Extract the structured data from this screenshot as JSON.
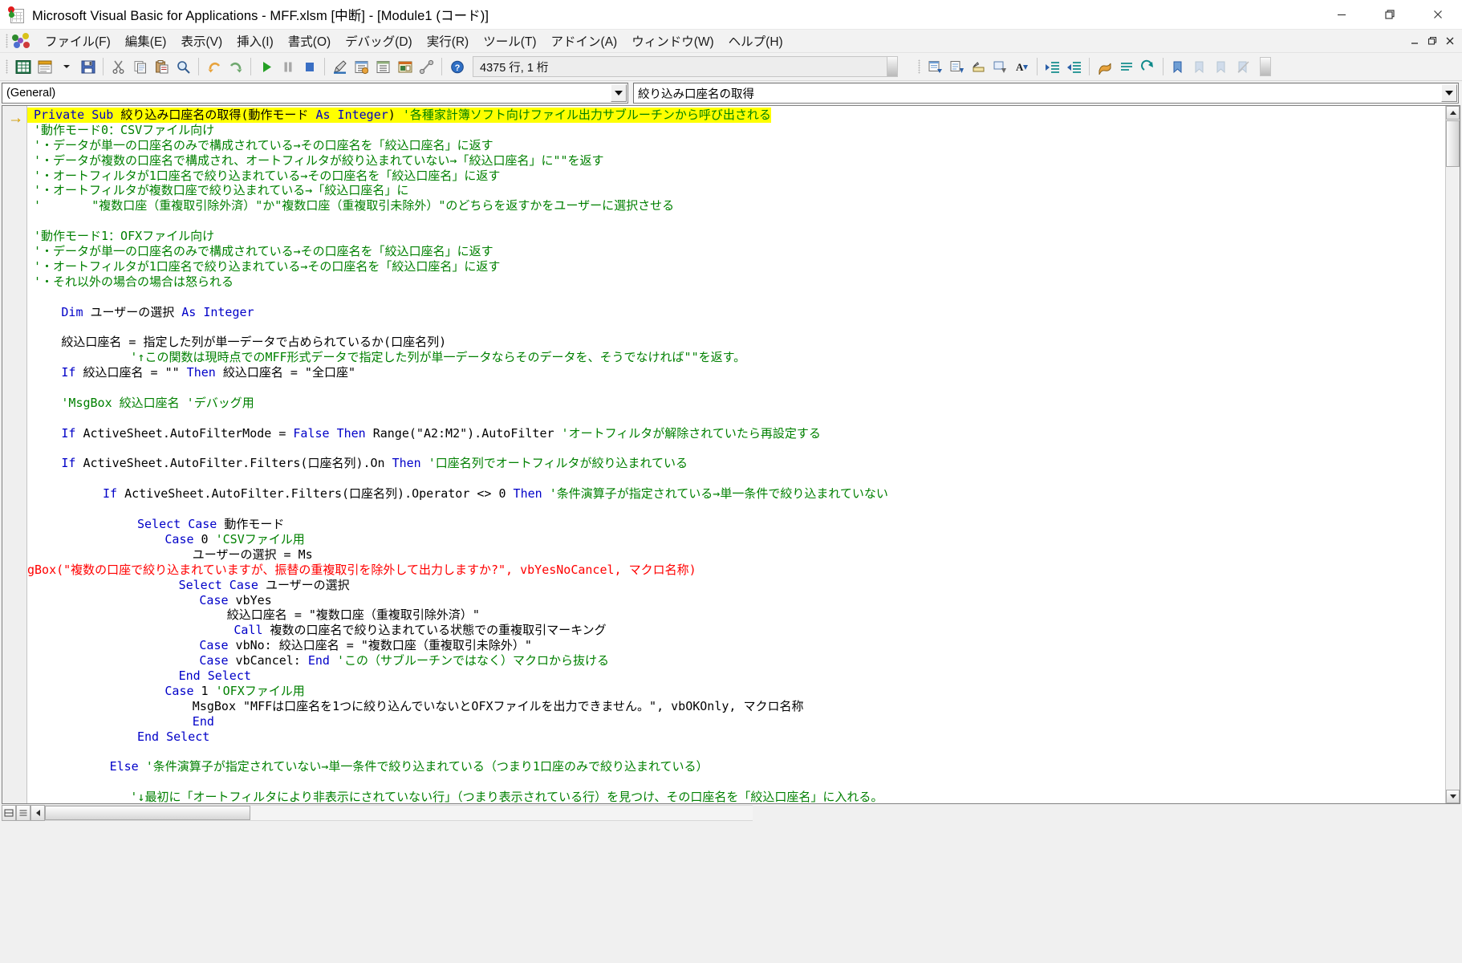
{
  "window": {
    "title": "Microsoft Visual Basic for Applications - MFF.xlsm [中断] - [Module1 (コード)]",
    "icon": "vba-excel-icon",
    "minimize_label": "最小化",
    "restore_label": "元のサイズに戻す",
    "close_label": "閉じる"
  },
  "menubar": {
    "items": [
      {
        "label": "ファイル(F)",
        "name": "menu-file"
      },
      {
        "label": "編集(E)",
        "name": "menu-edit"
      },
      {
        "label": "表示(V)",
        "name": "menu-view"
      },
      {
        "label": "挿入(I)",
        "name": "menu-insert"
      },
      {
        "label": "書式(O)",
        "name": "menu-format"
      },
      {
        "label": "デバッグ(D)",
        "name": "menu-debug"
      },
      {
        "label": "実行(R)",
        "name": "menu-run"
      },
      {
        "label": "ツール(T)",
        "name": "menu-tools"
      },
      {
        "label": "アドイン(A)",
        "name": "menu-addins"
      },
      {
        "label": "ウィンドウ(W)",
        "name": "menu-window"
      },
      {
        "label": "ヘルプ(H)",
        "name": "menu-help"
      }
    ]
  },
  "toolbar": {
    "status_text": "4375 行, 1 桁",
    "buttons": [
      "view-excel-icon",
      "insert-userform-icon",
      "save-icon",
      "cut-icon",
      "copy-icon",
      "paste-icon",
      "find-icon",
      "undo-icon",
      "redo-icon",
      "run-icon",
      "break-icon",
      "reset-icon",
      "design-mode-icon",
      "project-explorer-icon",
      "properties-window-icon",
      "object-browser-icon",
      "toolbox-icon",
      "help-icon"
    ],
    "edit_buttons": [
      "list-properties-icon",
      "list-constants-icon",
      "quick-info-icon",
      "parameter-info-icon",
      "complete-word-icon",
      "indent-icon",
      "outdent-icon",
      "toggle-breakpoint-icon",
      "comment-block-icon",
      "uncomment-block-icon",
      "toggle-bookmark-icon",
      "next-bookmark-icon",
      "prev-bookmark-icon",
      "clear-bookmarks-icon"
    ]
  },
  "combos": {
    "object": "(General)",
    "procedure": "絞り込み口座名の取得"
  },
  "code": {
    "current_line_marker": "→",
    "lines": [
      {
        "indent": 0,
        "highlight": true,
        "segments": [
          {
            "t": "Private Sub ",
            "c": "kw"
          },
          {
            "t": "絞り込み口座名の取得(動作モード ",
            "c": "blk"
          },
          {
            "t": "As Integer",
            "c": "kw"
          },
          {
            "t": ")",
            "c": "blk"
          },
          {
            "t": " '各種家計簿ソフト向けファイル出力サブルーチンから呼び出される",
            "c": "cm"
          }
        ]
      },
      {
        "indent": 0,
        "segments": [
          {
            "t": "'動作モード0：CSVファイル向け",
            "c": "cm"
          }
        ]
      },
      {
        "indent": 0,
        "segments": [
          {
            "t": "'・データが単一の口座名のみで構成されている→その口座名を「絞込口座名」に返す",
            "c": "cm"
          }
        ]
      },
      {
        "indent": 0,
        "segments": [
          {
            "t": "'・データが複数の口座名で構成され、オートフィルタが絞り込まれていない→「絞込口座名」に\"\"を返す",
            "c": "cm"
          }
        ]
      },
      {
        "indent": 0,
        "segments": [
          {
            "t": "'・オートフィルタが1口座名で絞り込まれている→その口座名を「絞込口座名」に返す",
            "c": "cm"
          }
        ]
      },
      {
        "indent": 0,
        "segments": [
          {
            "t": "'・オートフィルタが複数口座で絞り込まれている→「絞込口座名」に",
            "c": "cm"
          }
        ]
      },
      {
        "indent": 0,
        "segments": [
          {
            "t": "'       \"複数口座（重複取引除外済）\"か\"複数口座（重複取引未除外）\"のどちらを返すかをユーザーに選択させる",
            "c": "cm"
          }
        ]
      },
      {
        "indent": 0,
        "segments": [
          {
            "t": "",
            "c": "blk"
          }
        ]
      },
      {
        "indent": 0,
        "segments": [
          {
            "t": "'動作モード1：OFXファイル向け",
            "c": "cm"
          }
        ]
      },
      {
        "indent": 0,
        "segments": [
          {
            "t": "'・データが単一の口座名のみで構成されている→その口座名を「絞込口座名」に返す",
            "c": "cm"
          }
        ]
      },
      {
        "indent": 0,
        "segments": [
          {
            "t": "'・オートフィルタが1口座名で絞り込まれている→その口座名を「絞込口座名」に返す",
            "c": "cm"
          }
        ]
      },
      {
        "indent": 0,
        "segments": [
          {
            "t": "'・それ以外の場合の場合は怒られる",
            "c": "cm"
          }
        ]
      },
      {
        "indent": 0,
        "segments": [
          {
            "t": "",
            "c": "blk"
          }
        ]
      },
      {
        "indent": 4,
        "segments": [
          {
            "t": "Dim ",
            "c": "kw"
          },
          {
            "t": "ユーザーの選択 ",
            "c": "blk"
          },
          {
            "t": "As Integer",
            "c": "kw"
          }
        ]
      },
      {
        "indent": 0,
        "segments": [
          {
            "t": "",
            "c": "blk"
          }
        ]
      },
      {
        "indent": 4,
        "segments": [
          {
            "t": "絞込口座名 = 指定した列が単一データで占められているか(口座名列)",
            "c": "blk"
          }
        ]
      },
      {
        "indent": 14,
        "segments": [
          {
            "t": "'↑この関数は現時点でのMFF形式データで指定した列が単一データならそのデータを、そうでなければ\"\"を返す。",
            "c": "cm"
          }
        ]
      },
      {
        "indent": 4,
        "segments": [
          {
            "t": "If ",
            "c": "kw"
          },
          {
            "t": "絞込口座名 = \"\" ",
            "c": "blk"
          },
          {
            "t": "Then ",
            "c": "kw"
          },
          {
            "t": "絞込口座名 = \"全口座\"",
            "c": "blk"
          }
        ]
      },
      {
        "indent": 0,
        "segments": [
          {
            "t": "",
            "c": "blk"
          }
        ]
      },
      {
        "indent": 4,
        "segments": [
          {
            "t": "'MsgBox 絞込口座名 'デバッグ用",
            "c": "cm"
          }
        ]
      },
      {
        "indent": 0,
        "segments": [
          {
            "t": "",
            "c": "blk"
          }
        ]
      },
      {
        "indent": 4,
        "segments": [
          {
            "t": "If ",
            "c": "kw"
          },
          {
            "t": "ActiveSheet.AutoFilterMode = ",
            "c": "blk"
          },
          {
            "t": "False Then ",
            "c": "kw"
          },
          {
            "t": "Range(\"A2:M2\").AutoFilter ",
            "c": "blk"
          },
          {
            "t": "'オートフィルタが解除されていたら再設定する",
            "c": "cm"
          }
        ]
      },
      {
        "indent": 0,
        "segments": [
          {
            "t": "",
            "c": "blk"
          }
        ]
      },
      {
        "indent": 4,
        "segments": [
          {
            "t": "If ",
            "c": "kw"
          },
          {
            "t": "ActiveSheet.AutoFilter.Filters(口座名列).On ",
            "c": "blk"
          },
          {
            "t": "Then ",
            "c": "kw"
          },
          {
            "t": "'口座名列でオートフィルタが絞り込まれている",
            "c": "cm"
          }
        ]
      },
      {
        "indent": 0,
        "segments": [
          {
            "t": "",
            "c": "blk"
          }
        ]
      },
      {
        "indent": 10,
        "segments": [
          {
            "t": "If ",
            "c": "kw"
          },
          {
            "t": "ActiveSheet.AutoFilter.Filters(口座名列).Operator <> 0 ",
            "c": "blk"
          },
          {
            "t": "Then ",
            "c": "kw"
          },
          {
            "t": "'条件演算子が指定されている→単一条件で絞り込まれていない",
            "c": "cm"
          }
        ]
      },
      {
        "indent": 0,
        "segments": [
          {
            "t": "",
            "c": "blk"
          }
        ]
      },
      {
        "indent": 15,
        "segments": [
          {
            "t": "Select Case ",
            "c": "kw"
          },
          {
            "t": "動作モード",
            "c": "blk"
          }
        ]
      },
      {
        "indent": 19,
        "segments": [
          {
            "t": "Case ",
            "c": "kw"
          },
          {
            "t": "0 ",
            "c": "blk"
          },
          {
            "t": "'CSVファイル用",
            "c": "cm"
          }
        ]
      },
      {
        "indent": 23,
        "segments": [
          {
            "t": "ユーザーの選択 = Ms",
            "c": "blk"
          }
        ]
      },
      {
        "indent": -1,
        "segments": [
          {
            "t": "gBox(\"複数の口座で絞り込まれていますが、振替の重複取引を除外して出力しますか?\", vbYesNoCancel, マクロ名称)",
            "c": "err"
          }
        ]
      },
      {
        "indent": 21,
        "segments": [
          {
            "t": "Select Case ",
            "c": "kw"
          },
          {
            "t": "ユーザーの選択",
            "c": "blk"
          }
        ]
      },
      {
        "indent": 24,
        "segments": [
          {
            "t": "Case ",
            "c": "kw"
          },
          {
            "t": "vbYes",
            "c": "blk"
          }
        ]
      },
      {
        "indent": 28,
        "segments": [
          {
            "t": "絞込口座名 = \"複数口座（重複取引除外済）\"",
            "c": "blk"
          }
        ]
      },
      {
        "indent": 29,
        "segments": [
          {
            "t": "Call ",
            "c": "kw"
          },
          {
            "t": "複数の口座名で絞り込まれている状態での重複取引マーキング",
            "c": "blk"
          }
        ]
      },
      {
        "indent": 24,
        "segments": [
          {
            "t": "Case ",
            "c": "kw"
          },
          {
            "t": "vbNo: 絞込口座名 = \"複数口座（重複取引未除外）\"",
            "c": "blk"
          }
        ]
      },
      {
        "indent": 24,
        "segments": [
          {
            "t": "Case ",
            "c": "kw"
          },
          {
            "t": "vbCancel: ",
            "c": "blk"
          },
          {
            "t": "End ",
            "c": "kw"
          },
          {
            "t": "'この（サブルーチンではなく）マクロから抜ける",
            "c": "cm"
          }
        ]
      },
      {
        "indent": 21,
        "segments": [
          {
            "t": "End Select",
            "c": "kw"
          }
        ]
      },
      {
        "indent": 19,
        "segments": [
          {
            "t": "Case ",
            "c": "kw"
          },
          {
            "t": "1 ",
            "c": "blk"
          },
          {
            "t": "'OFXファイル用",
            "c": "cm"
          }
        ]
      },
      {
        "indent": 23,
        "segments": [
          {
            "t": "MsgBox \"MFFは口座名を1つに絞り込んでいないとOFXファイルを出力できません。\", vbOKOnly, マクロ名称",
            "c": "blk"
          }
        ]
      },
      {
        "indent": 23,
        "segments": [
          {
            "t": "End",
            "c": "kw"
          }
        ]
      },
      {
        "indent": 15,
        "segments": [
          {
            "t": "End Select",
            "c": "kw"
          }
        ]
      },
      {
        "indent": 0,
        "segments": [
          {
            "t": "",
            "c": "blk"
          }
        ]
      },
      {
        "indent": 11,
        "segments": [
          {
            "t": "Else ",
            "c": "kw"
          },
          {
            "t": "'条件演算子が指定されていない→単一条件で絞り込まれている（つまり1口座のみで絞り込まれている）",
            "c": "cm"
          }
        ]
      },
      {
        "indent": 0,
        "segments": [
          {
            "t": "",
            "c": "blk"
          }
        ]
      },
      {
        "indent": 14,
        "segments": [
          {
            "t": "'↓最初に「オートフィルタにより非表示にされていない行」（つまり表示されている行）を見つけ、その口座名を「絞込口座名」に入れる。",
            "c": "cm"
          }
        ]
      }
    ]
  },
  "statusbar": {
    "view_procedure_label": "プロシージャの表示",
    "view_module_label": "モジュールの表示"
  },
  "colors": {
    "keyword": "#0000c8",
    "comment": "#008000",
    "error": "#ff0000",
    "highlight": "#ffff00",
    "text": "#000000"
  }
}
